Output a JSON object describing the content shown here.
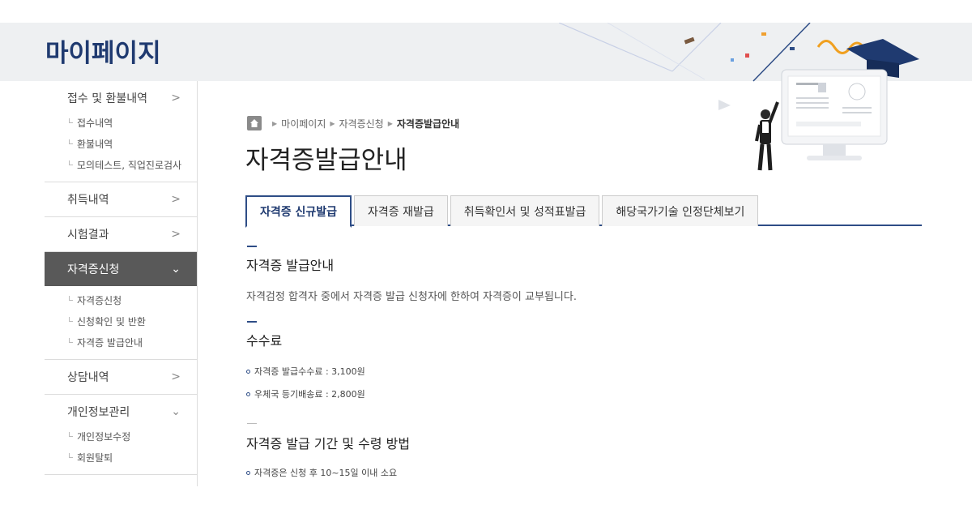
{
  "header": {
    "title": "마이페이지"
  },
  "sidebar": {
    "groups": [
      {
        "label": "접수 및 환불내역",
        "chevron": ">",
        "items": [
          "접수내역",
          "환불내역",
          "모의테스트, 직업진로검사"
        ]
      },
      {
        "label": "취득내역",
        "chevron": ">"
      },
      {
        "label": "시험결과",
        "chevron": ">"
      },
      {
        "label": "자격증신청",
        "chevron": "⌄",
        "items": [
          "자격증신청",
          "신청확인 및 반환",
          "자격증 발급안내"
        ]
      },
      {
        "label": "상담내역",
        "chevron": ">"
      },
      {
        "label": "개인정보관리",
        "chevron": "⌄",
        "items": [
          "개인정보수정",
          "회원탈퇴"
        ]
      }
    ]
  },
  "breadcrumb": {
    "items": [
      "마이페이지",
      "자격증신청"
    ],
    "current": "자격증발급안내",
    "separator": "▶"
  },
  "page_title": "자격증발급안내",
  "tabs": [
    {
      "label": "자격증 신규발급",
      "active": true
    },
    {
      "label": "자격증 재발급",
      "active": false
    },
    {
      "label": "취득확인서 및 성적표발급",
      "active": false
    },
    {
      "label": "해당국가기술 인정단체보기",
      "active": false
    }
  ],
  "content": {
    "section1": {
      "title": "자격증 발급안내",
      "text": "자격검정 합격자 중에서 자격증 발급 신청자에 한하여 자격증이 교부됩니다."
    },
    "section2": {
      "title": "수수료",
      "items": [
        "자격증 발급수수료 : 3,100원",
        "우체국 등기배송료 : 2,800원"
      ]
    },
    "section3": {
      "title": "자격증 발급 기간 및 수령 방법",
      "items": [
        "자격증은 신청 후 10~15일 이내 소요"
      ]
    }
  },
  "colors": {
    "primary": "#2e4d86",
    "header_bg": "#eef0f2",
    "sidebar_active": "#595959",
    "highlight": "#ec788c"
  },
  "icons": {
    "home": "home-icon",
    "chevron": "chevron-right-icon"
  }
}
